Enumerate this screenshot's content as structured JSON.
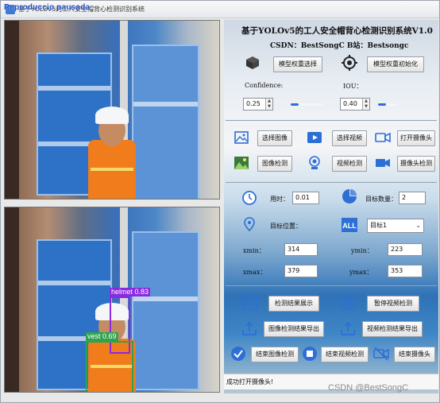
{
  "window": {
    "title": "基于YOLOv5的工人安全帽背心检测识别系统",
    "overlay_name": "Reproduccio pausada"
  },
  "panel": {
    "title": "基于YOLOv5的工人安全帽背心检测识别系统V1.0",
    "subtitle": "CSDN：BestSongC   B站：Bestsongc",
    "select_weights": "模型权重选择",
    "init_weights": "模型权重初始化",
    "confidence_label": "Confidence:",
    "confidence_value": "0.25",
    "confidence_level": 0.25,
    "iou_label": "IOU：",
    "iou_value": "0.40",
    "iou_level": 0.4,
    "select_image": "选择图像",
    "select_video": "选择视频",
    "open_camera": "打开摄像头",
    "image_detect": "图像检测",
    "video_detect": "视频检测",
    "camera_detect": "摄像头检测",
    "time_label": "用时：",
    "time_value": "0.01",
    "count_label": "目标数量：",
    "count_value": "2",
    "pos_label": "目标位置：",
    "target_select": "目标1",
    "xmin_label": "xmin：",
    "xmin_value": "314",
    "ymin_label": "ymin：",
    "ymin_value": "223",
    "xmax_label": "xmax：",
    "xmax_value": "379",
    "ymax_label": "ymax：",
    "ymax_value": "353",
    "show_results": "检测结果展示",
    "pause_video": "暂停视频检测",
    "export_image": "图像检测结果导出",
    "export_video": "视频检测结果导出",
    "end_image": "结束图像检测",
    "end_video": "结束视频检测",
    "end_camera": "结束摄像头"
  },
  "detections": [
    {
      "label": "helmet 0.83",
      "color": "#8a2be2"
    },
    {
      "label": "vest 0.69",
      "color": "#2ea44f"
    }
  ],
  "status": {
    "text": "成功打开摄像头!"
  },
  "watermark": "CSDN @BestSongC",
  "colors": {
    "accent": "#2e6fd6",
    "helmet_box": "#8a2be2",
    "vest_box": "#2ea44f"
  }
}
